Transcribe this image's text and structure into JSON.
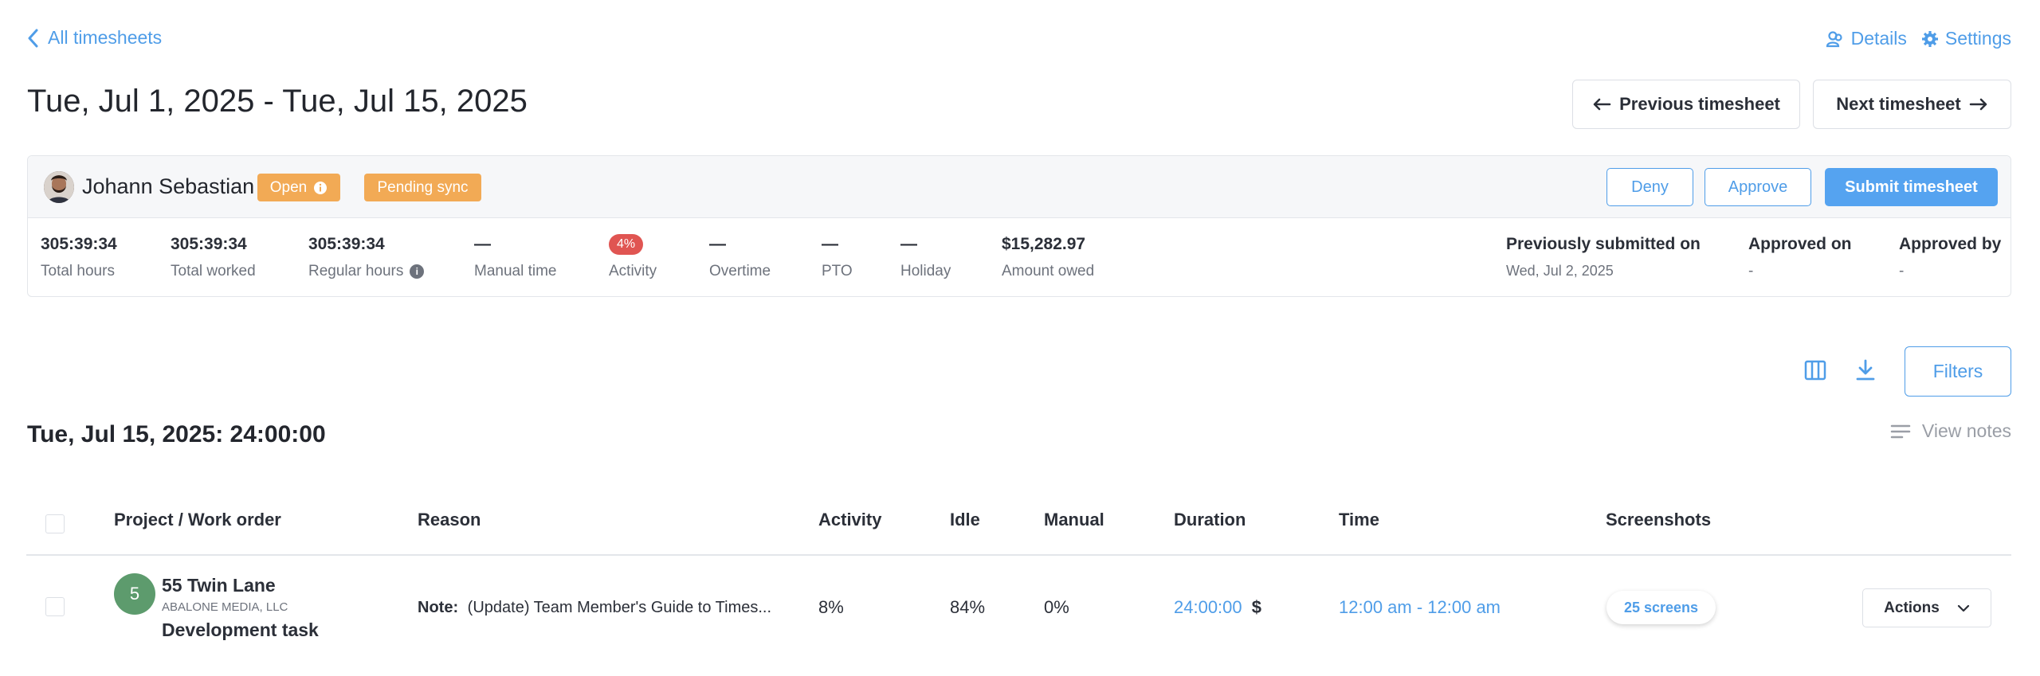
{
  "nav": {
    "back_label": "All timesheets",
    "details_label": "Details",
    "settings_label": "Settings"
  },
  "header": {
    "date_range": "Tue, Jul 1, 2025 - Tue, Jul 15, 2025",
    "prev_label": "Previous timesheet",
    "next_label": "Next timesheet"
  },
  "summary": {
    "user_name": "Johann Sebastian",
    "status_badge": "Open",
    "sync_badge": "Pending sync",
    "deny_label": "Deny",
    "approve_label": "Approve",
    "submit_label": "Submit timesheet",
    "stats": {
      "total_hours": {
        "value": "305:39:34",
        "label": "Total hours"
      },
      "total_worked": {
        "value": "305:39:34",
        "label": "Total worked"
      },
      "regular_hours": {
        "value": "305:39:34",
        "label": "Regular hours"
      },
      "manual_time": {
        "value": "—",
        "label": "Manual time"
      },
      "activity": {
        "value": "4%",
        "label": "Activity"
      },
      "overtime": {
        "value": "—",
        "label": "Overtime"
      },
      "pto": {
        "value": "—",
        "label": "PTO"
      },
      "holiday": {
        "value": "—",
        "label": "Holiday"
      },
      "amount_owed": {
        "value": "$15,282.97",
        "label": "Amount owed"
      }
    },
    "previously_submitted": {
      "label": "Previously submitted on",
      "value": "Wed, Jul 2, 2025"
    },
    "approved_on": {
      "label": "Approved on",
      "value": "-"
    },
    "approved_by": {
      "label": "Approved by",
      "value": "-"
    }
  },
  "toolbar": {
    "filters_label": "Filters",
    "view_notes_label": "View notes"
  },
  "day": {
    "title": "Tue, Jul 15, 2025: 24:00:00"
  },
  "table": {
    "columns": [
      "Project / Work order",
      "Reason",
      "Activity",
      "Idle",
      "Manual",
      "Duration",
      "Time",
      "Screenshots"
    ],
    "rows": [
      {
        "project_number": "5",
        "project_name": "55 Twin Lane",
        "client": "ABALONE MEDIA, LLC",
        "task": "Development task",
        "note_label": "Note:",
        "note_text": "(Update) Team Member's Guide to Times...",
        "activity": "8%",
        "idle": "84%",
        "manual": "0%",
        "duration": "24:00:00",
        "currency_symbol": "$",
        "time": "12:00 am - 12:00 am",
        "screenshots": "25 screens",
        "actions_label": "Actions"
      }
    ]
  },
  "colors": {
    "accent": "#4f9de8",
    "badge_orange": "#f2aa55",
    "activity_red": "#e05552",
    "project_green": "#5d9b6d"
  },
  "icons": [
    "chevron-left-icon",
    "users-icon",
    "gear-icon",
    "arrow-left-icon",
    "arrow-right-icon",
    "info-icon",
    "columns-icon",
    "download-icon",
    "notes-lines-icon",
    "chevron-down-icon"
  ]
}
